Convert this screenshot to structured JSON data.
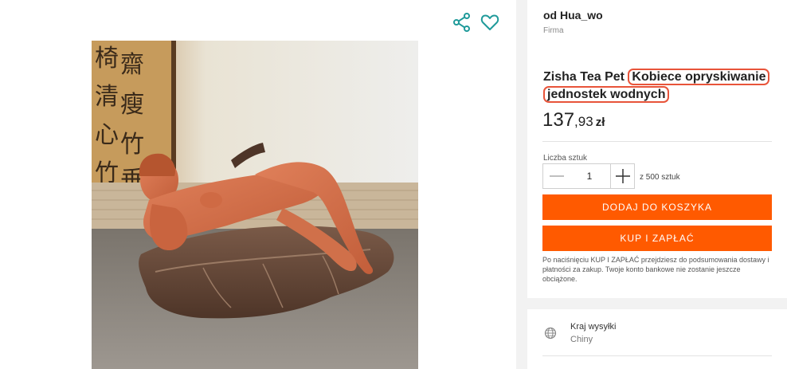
{
  "seller": {
    "name": "od Hua_wo",
    "type": "Firma"
  },
  "product": {
    "title_plain": "Zisha Tea Pet",
    "title_highlight_1": "Kobiece opryskiwanie",
    "title_highlight_2": "jednostek wodnych",
    "price_int": "137",
    "price_dec": ",93",
    "currency": "zł"
  },
  "quantity": {
    "label": "Liczba sztuk",
    "value": "1",
    "of_text": "z 500 sztuk",
    "minus_glyph": "—",
    "plus_glyph": "+"
  },
  "actions": {
    "add_to_cart": "DODAJ DO KOSZYKA",
    "buy_and_pay": "KUP I ZAPŁAĆ",
    "note": "Po naciśnięciu KUP I ZAPŁAĆ przejdziesz do podsumowania dostawy i płatności za zakup. Twoje konto bankowe nie zostanie jeszcze obciążone."
  },
  "shipping": {
    "label": "Kraj wysyłki",
    "value": "Chiny",
    "icon": "globe-icon"
  },
  "icons": {
    "share": "share-icon",
    "favorite": "heart-icon"
  },
  "colors": {
    "accent": "#ff5a00",
    "icon_teal": "#1f9a9a",
    "highlight_border": "#e8543a"
  }
}
